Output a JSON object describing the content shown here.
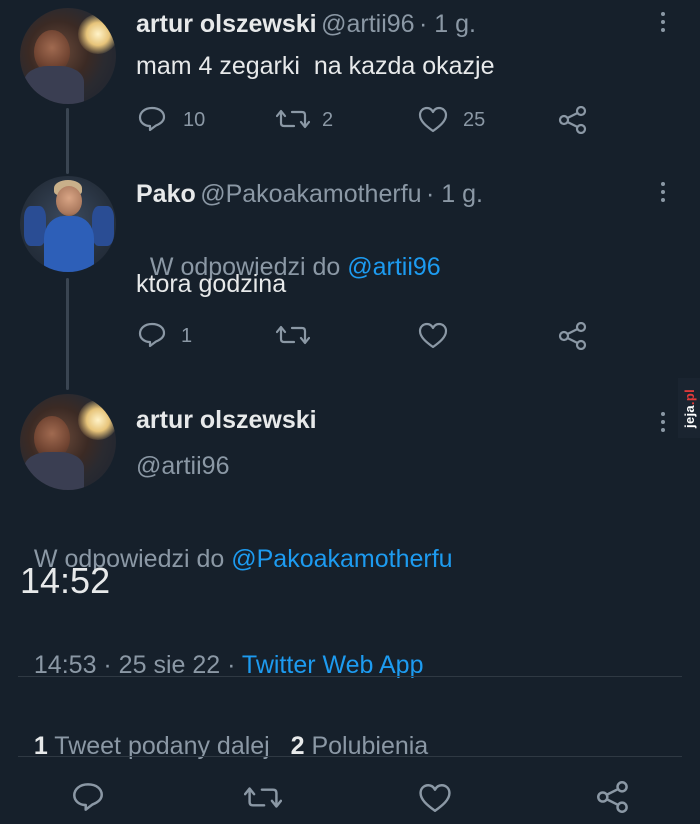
{
  "tweet1": {
    "author_name": "artur olszewski",
    "author_handle": "@artii96",
    "time": "· 1 g.",
    "text": "mam 4 zegarki  na kazda okazje",
    "replies": "10",
    "retweets": "2",
    "likes": "25"
  },
  "tweet2": {
    "author_name": "Pako",
    "author_handle": "@Pakoakamotherfu",
    "time": "· 1 g.",
    "reply_prefix": "W odpowiedzi do ",
    "reply_to": "@artii96",
    "text": "ktora godzina",
    "replies": "1"
  },
  "main_tweet": {
    "author_name": "artur olszewski",
    "author_handle": "@artii96",
    "reply_prefix": "W odpowiedzi do ",
    "reply_to": "@Pakoakamotherfu",
    "text": "14:52",
    "timestamp": "14:53 · 25 sie 22 · ",
    "source": "Twitter Web App",
    "retweet_count": "1",
    "retweet_label": " Tweet podany dalej",
    "like_count": "2",
    "like_label": " Polubienia"
  },
  "watermark": {
    "brand": "jeja",
    "tld": ".pl"
  },
  "colors": {
    "background": "#16202b",
    "text": "#e7e9ea",
    "muted": "#8b98a5",
    "link": "#1d9bf0"
  }
}
